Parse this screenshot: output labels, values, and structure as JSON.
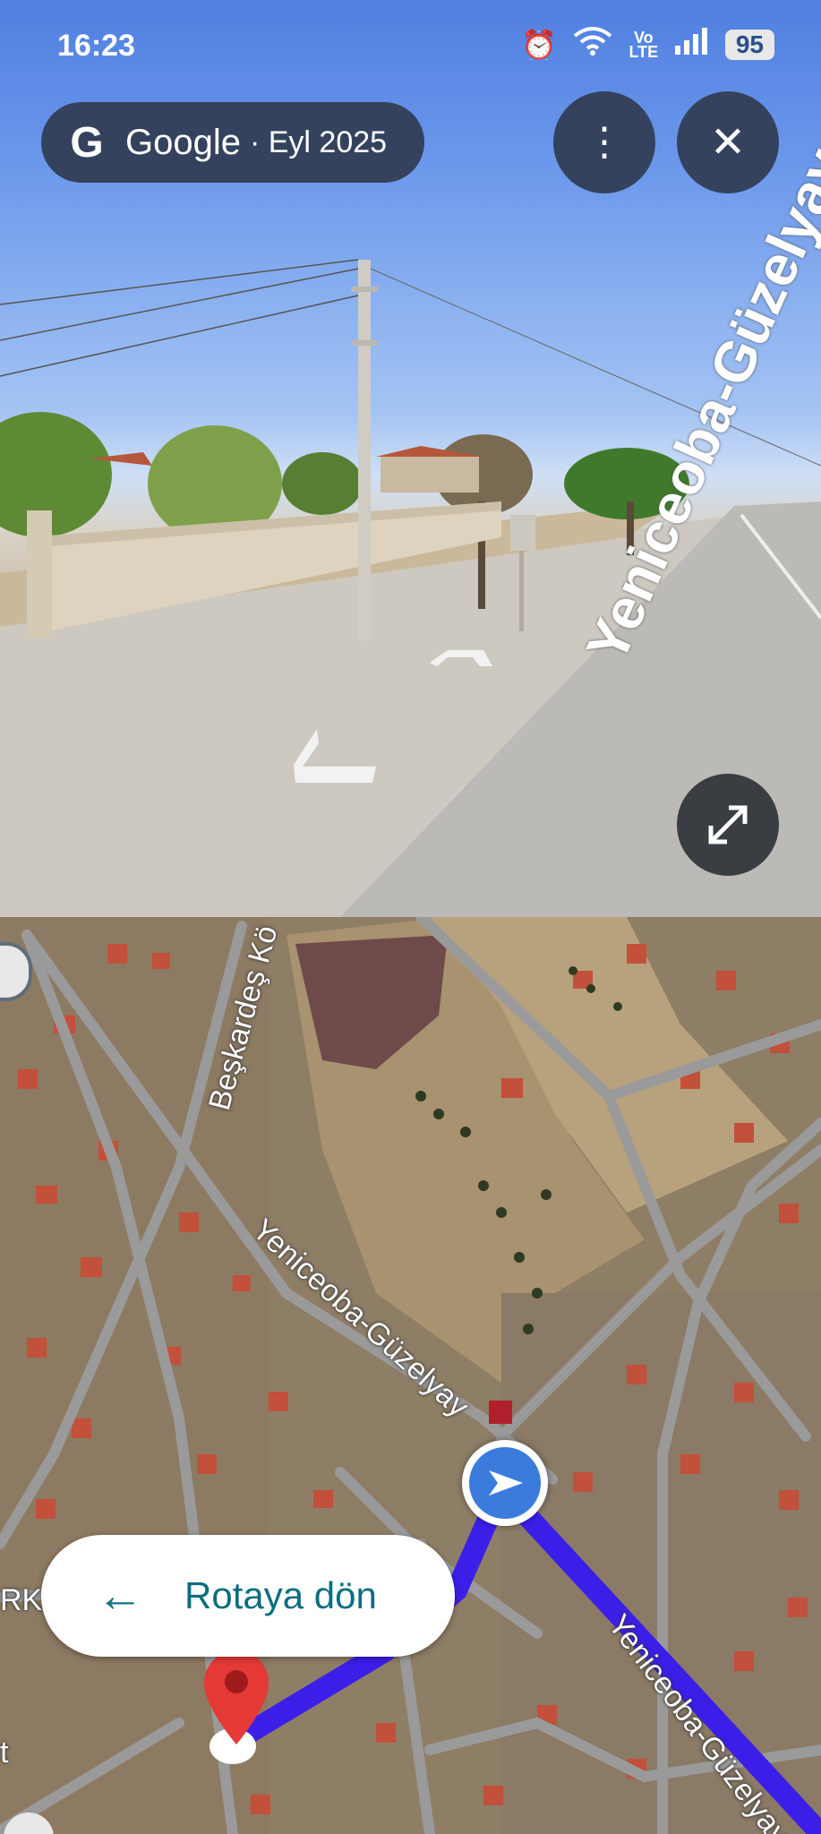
{
  "status": {
    "time": "16:23",
    "network": "Vo LTE",
    "battery": "95"
  },
  "attribution": {
    "brand": "Google",
    "date": "· Eyl 2025"
  },
  "streetview": {
    "road_sign": "Yeniceoba-Güzelyay"
  },
  "map": {
    "labels": {
      "road_top_left": "Beşkardeş Kö",
      "road_main": "Yeniceoba-Güzelyay",
      "road_lower": "Yeniceoba-Güzelyay",
      "edge_rk": "RK",
      "edge_t": "t"
    }
  },
  "return_button": {
    "label": "Rotaya dön"
  },
  "colors": {
    "route": "#3b1fe8",
    "location_dot": "#3a7bdc",
    "pin": "#e53935",
    "accent": "#0b7285"
  }
}
